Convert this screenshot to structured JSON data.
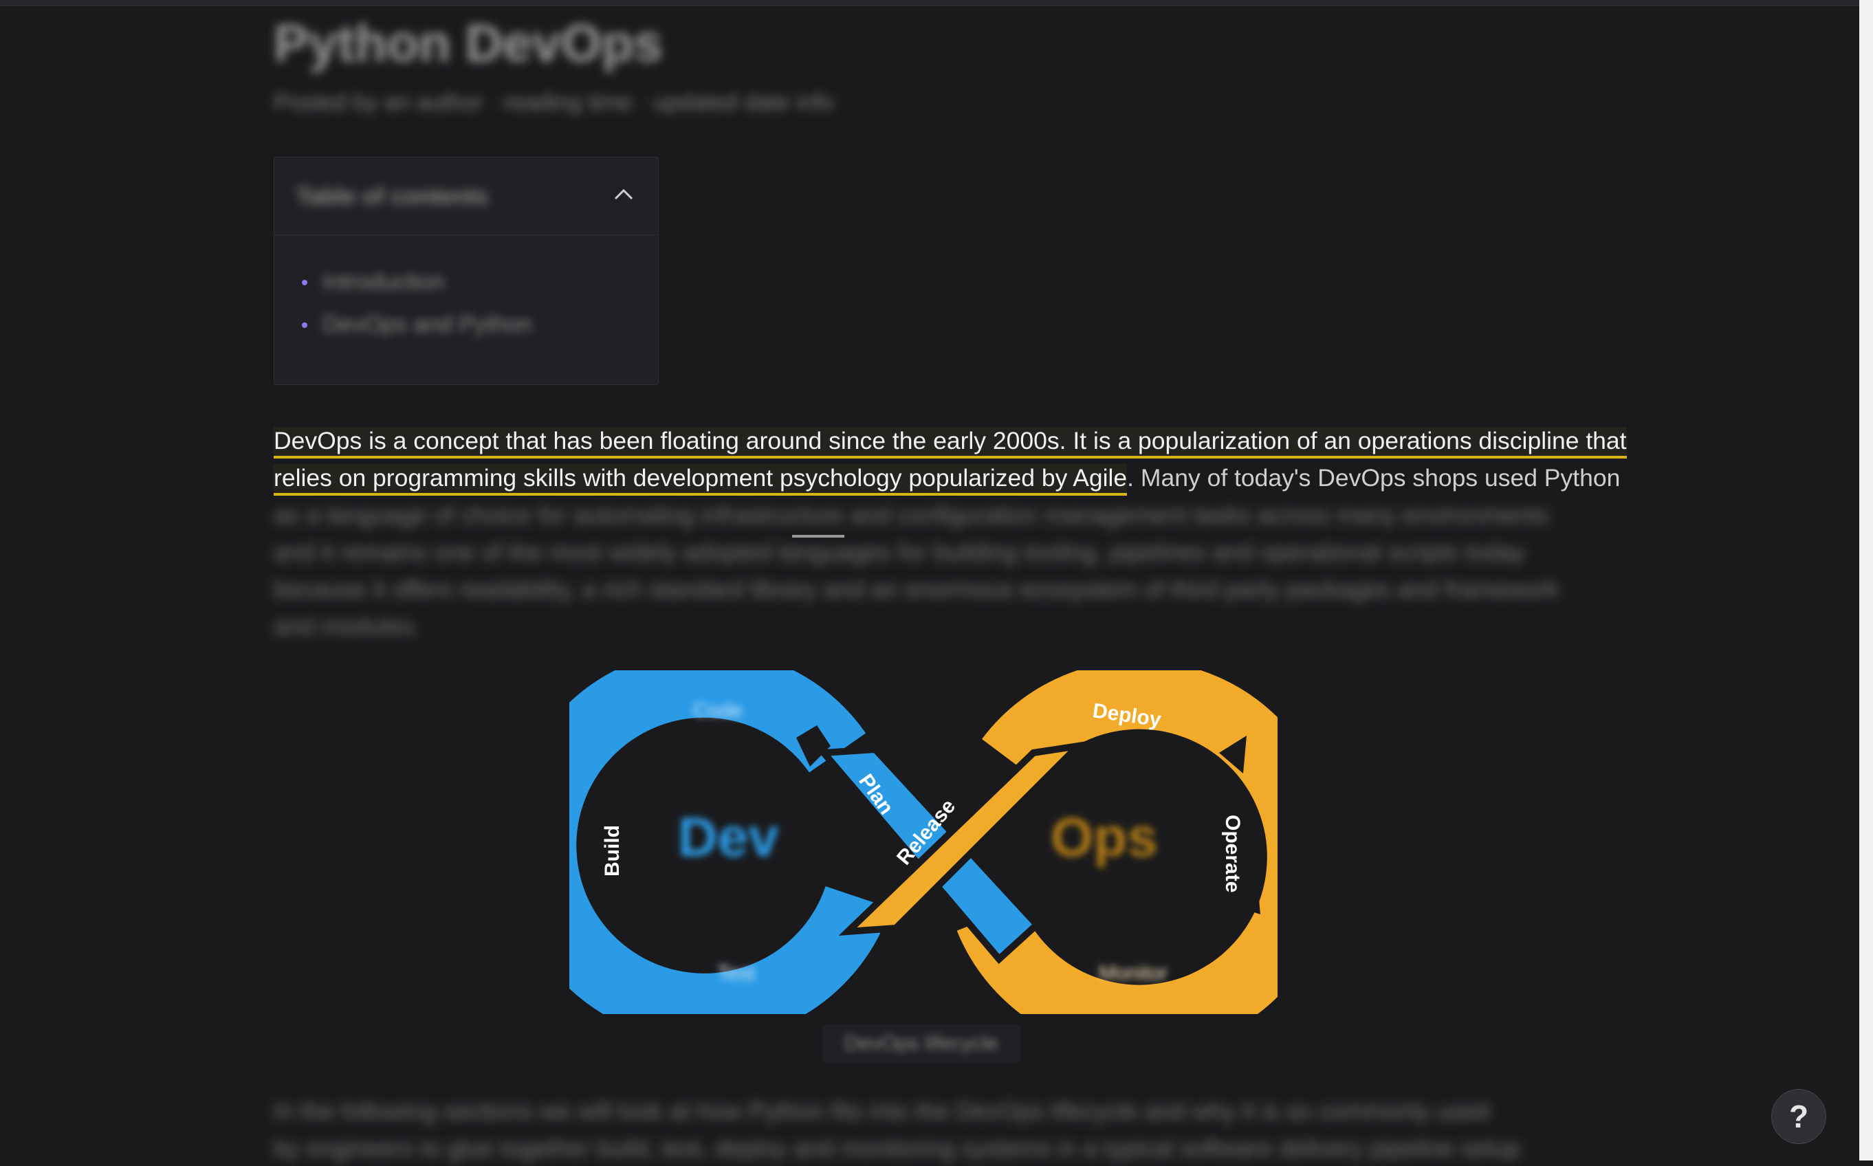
{
  "page": {
    "title": "Python DevOps",
    "meta": "Posted by an author · reading time · updated date info"
  },
  "toc": {
    "title": "Table of contents",
    "items": [
      {
        "label": "Introduction"
      },
      {
        "label": "DevOps and Python"
      }
    ]
  },
  "article": {
    "highlight_line1": "DevOps is a concept that has been floating around since the early 2000s. It is a popularization of an operations discipline that",
    "highlight_line2": "relies on programming skills with development psychology popularized by Agile",
    "tail_line2": ". Many of today's DevOps shops used Python",
    "blurred_lines": [
      "as a language of choice for automating infrastructure and configuration management tasks across many environments",
      "and it remains one of the most widely adopted languages for building tooling, pipelines and operational scripts today",
      "because it offers readability, a rich standard library and an enormous ecosystem of third party packages and frameworks",
      "and modules."
    ],
    "second_paragraph": [
      "In the following sections we will look at how Python fits into the DevOps lifecycle and why it is so commonly used",
      "by engineers to glue together build, test, deploy and monitoring systems in a typical software delivery pipeline setup"
    ]
  },
  "diagram": {
    "labels": {
      "deploy": "Deploy",
      "operate": "Operate",
      "release": "Release",
      "plan": "Plan",
      "build": "Build",
      "blurred_left_top": "Code",
      "blurred_left_bottom": "Test",
      "blurred_right_bottom": "Monitor",
      "blurred_left_center": "Dev",
      "blurred_right_center": "Ops"
    },
    "colors": {
      "blue": "#2b9be6",
      "orange": "#f2aa2a",
      "dark": "#1a1a1d"
    },
    "caption": "DevOps lifecycle"
  },
  "help_button": {
    "label": "?"
  }
}
